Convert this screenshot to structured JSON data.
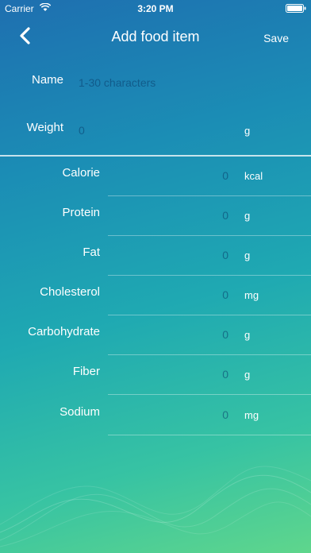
{
  "status_bar": {
    "carrier": "Carrier",
    "time": "3:20 PM"
  },
  "nav": {
    "title": "Add food item",
    "save_label": "Save"
  },
  "form": {
    "name_label": "Name",
    "name_placeholder": "1-30 characters",
    "weight_label": "Weight",
    "weight_value": "0",
    "weight_unit": "g"
  },
  "nutrients": [
    {
      "label": "Calorie",
      "value": "0",
      "unit": "kcal"
    },
    {
      "label": "Protein",
      "value": "0",
      "unit": "g"
    },
    {
      "label": "Fat",
      "value": "0",
      "unit": "g"
    },
    {
      "label": "Cholesterol",
      "value": "0",
      "unit": "mg"
    },
    {
      "label": "Carbohydrate",
      "value": "0",
      "unit": "g"
    },
    {
      "label": "Fiber",
      "value": "0",
      "unit": "g"
    },
    {
      "label": "Sodium",
      "value": "0",
      "unit": "mg"
    }
  ],
  "colors": {
    "background_top": "#1e6fb0",
    "background_bottom": "#5fd68c",
    "text": "#ffffff",
    "placeholder": "#0a3c69"
  }
}
